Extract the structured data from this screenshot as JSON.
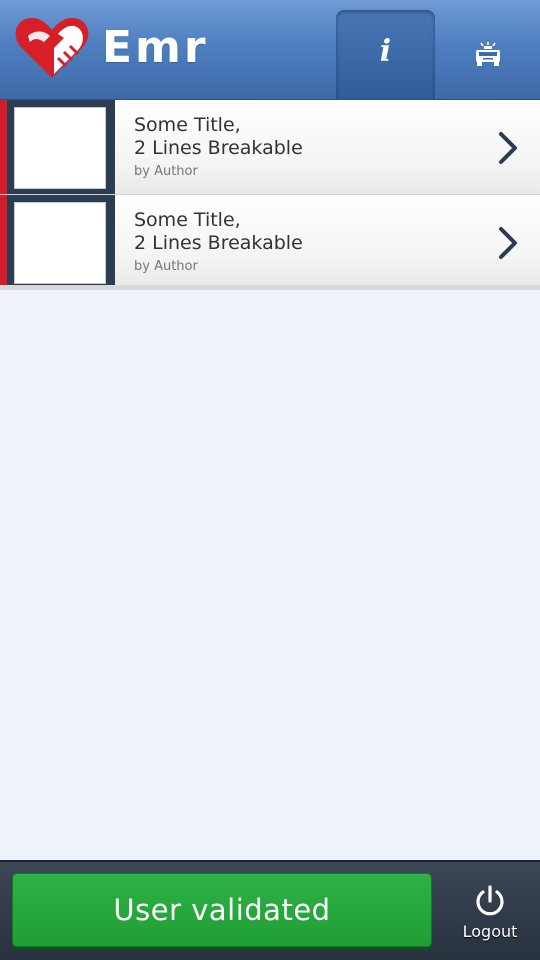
{
  "header": {
    "app_name": "Emr",
    "tabs": [
      {
        "id": "info",
        "icon": "info-icon",
        "active": true
      },
      {
        "id": "ambulance",
        "icon": "ambulance-icon",
        "active": false
      }
    ]
  },
  "list": {
    "items": [
      {
        "title": "Some Title,\n2 Lines Breakable",
        "author": "by Author"
      },
      {
        "title": "Some Title,\n2 Lines Breakable",
        "author": "by Author"
      }
    ]
  },
  "footer": {
    "status_button_label": "User validated",
    "logout_label": "Logout"
  },
  "colors": {
    "header_blue": "#4f7fc0",
    "accent_red": "#d31d2a",
    "success_green": "#22a53a",
    "footer_dark": "#2e3746",
    "background": "#eef2fa"
  }
}
